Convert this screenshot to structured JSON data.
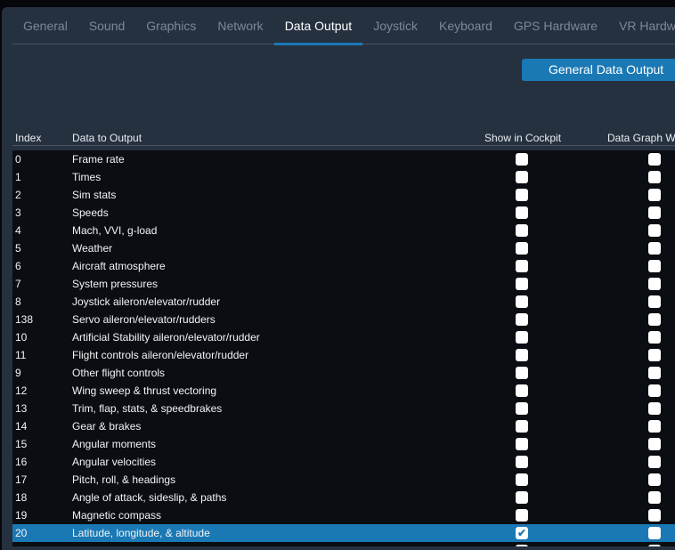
{
  "tabs": [
    "General",
    "Sound",
    "Graphics",
    "Network",
    "Data Output",
    "Joystick",
    "Keyboard",
    "GPS Hardware",
    "VR Hardw"
  ],
  "active_tab": "Data Output",
  "general_button": "General Data Output",
  "columns": {
    "index": "Index",
    "data": "Data to Output",
    "cockpit": "Show in Cockpit",
    "graph": "Data Graph W"
  },
  "rows": [
    {
      "index": "0",
      "name": "Frame rate",
      "cockpit": false,
      "graph": false
    },
    {
      "index": "1",
      "name": "Times",
      "cockpit": false,
      "graph": false
    },
    {
      "index": "2",
      "name": "Sim stats",
      "cockpit": false,
      "graph": false
    },
    {
      "index": "3",
      "name": "Speeds",
      "cockpit": false,
      "graph": false
    },
    {
      "index": "4",
      "name": "Mach, VVI, g-load",
      "cockpit": false,
      "graph": false
    },
    {
      "index": "5",
      "name": "Weather",
      "cockpit": false,
      "graph": false
    },
    {
      "index": "6",
      "name": "Aircraft atmosphere",
      "cockpit": false,
      "graph": false
    },
    {
      "index": "7",
      "name": "System pressures",
      "cockpit": false,
      "graph": false
    },
    {
      "index": "8",
      "name": "Joystick aileron/elevator/rudder",
      "cockpit": false,
      "graph": false
    },
    {
      "index": "138",
      "name": "Servo aileron/elevator/rudders",
      "cockpit": false,
      "graph": false
    },
    {
      "index": "10",
      "name": "Artificial Stability aileron/elevator/rudder",
      "cockpit": false,
      "graph": false
    },
    {
      "index": "11",
      "name": "Flight controls aileron/elevator/rudder",
      "cockpit": false,
      "graph": false
    },
    {
      "index": "9",
      "name": "Other flight controls",
      "cockpit": false,
      "graph": false
    },
    {
      "index": "12",
      "name": "Wing sweep & thrust vectoring",
      "cockpit": false,
      "graph": false
    },
    {
      "index": "13",
      "name": "Trim, flap, stats, & speedbrakes",
      "cockpit": false,
      "graph": false
    },
    {
      "index": "14",
      "name": "Gear & brakes",
      "cockpit": false,
      "graph": false
    },
    {
      "index": "15",
      "name": "Angular moments",
      "cockpit": false,
      "graph": false
    },
    {
      "index": "16",
      "name": "Angular velocities",
      "cockpit": false,
      "graph": false
    },
    {
      "index": "17",
      "name": "Pitch, roll, & headings",
      "cockpit": false,
      "graph": false
    },
    {
      "index": "18",
      "name": "Angle of attack, sideslip, & paths",
      "cockpit": false,
      "graph": false
    },
    {
      "index": "19",
      "name": "Magnetic compass",
      "cockpit": false,
      "graph": false
    },
    {
      "index": "20",
      "name": "Latitude, longitude, & altitude",
      "cockpit": true,
      "graph": false,
      "selected": true
    }
  ]
}
